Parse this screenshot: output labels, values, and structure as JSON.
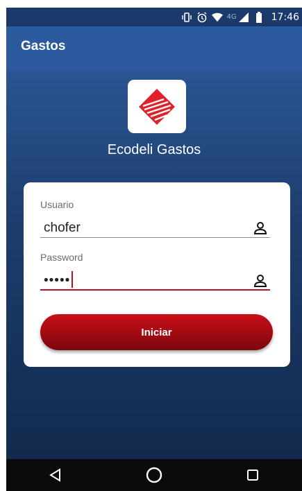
{
  "status_bar": {
    "network": "4G",
    "time": "17:46",
    "icons": [
      "vibrate-icon",
      "alarm-icon",
      "wifi-icon",
      "signal-icon",
      "battery-icon"
    ]
  },
  "app_bar": {
    "title": "Gastos"
  },
  "logo": {
    "icon": "ecodeli-logo-icon",
    "brand_color": "#e0202a"
  },
  "brand_name": "Ecodeli Gastos",
  "form": {
    "username": {
      "label": "Usuario",
      "value": "chofer",
      "icon": "person-icon"
    },
    "password": {
      "label": "Password",
      "value": "•••••",
      "icon": "person-icon"
    },
    "submit_label": "Iniciar"
  },
  "colors": {
    "app_bar": "#2c5a9e",
    "accent": "#b0161f",
    "button": "#a00a12"
  },
  "nav_bar": {
    "buttons": [
      "back-icon",
      "home-icon",
      "recents-icon"
    ]
  }
}
